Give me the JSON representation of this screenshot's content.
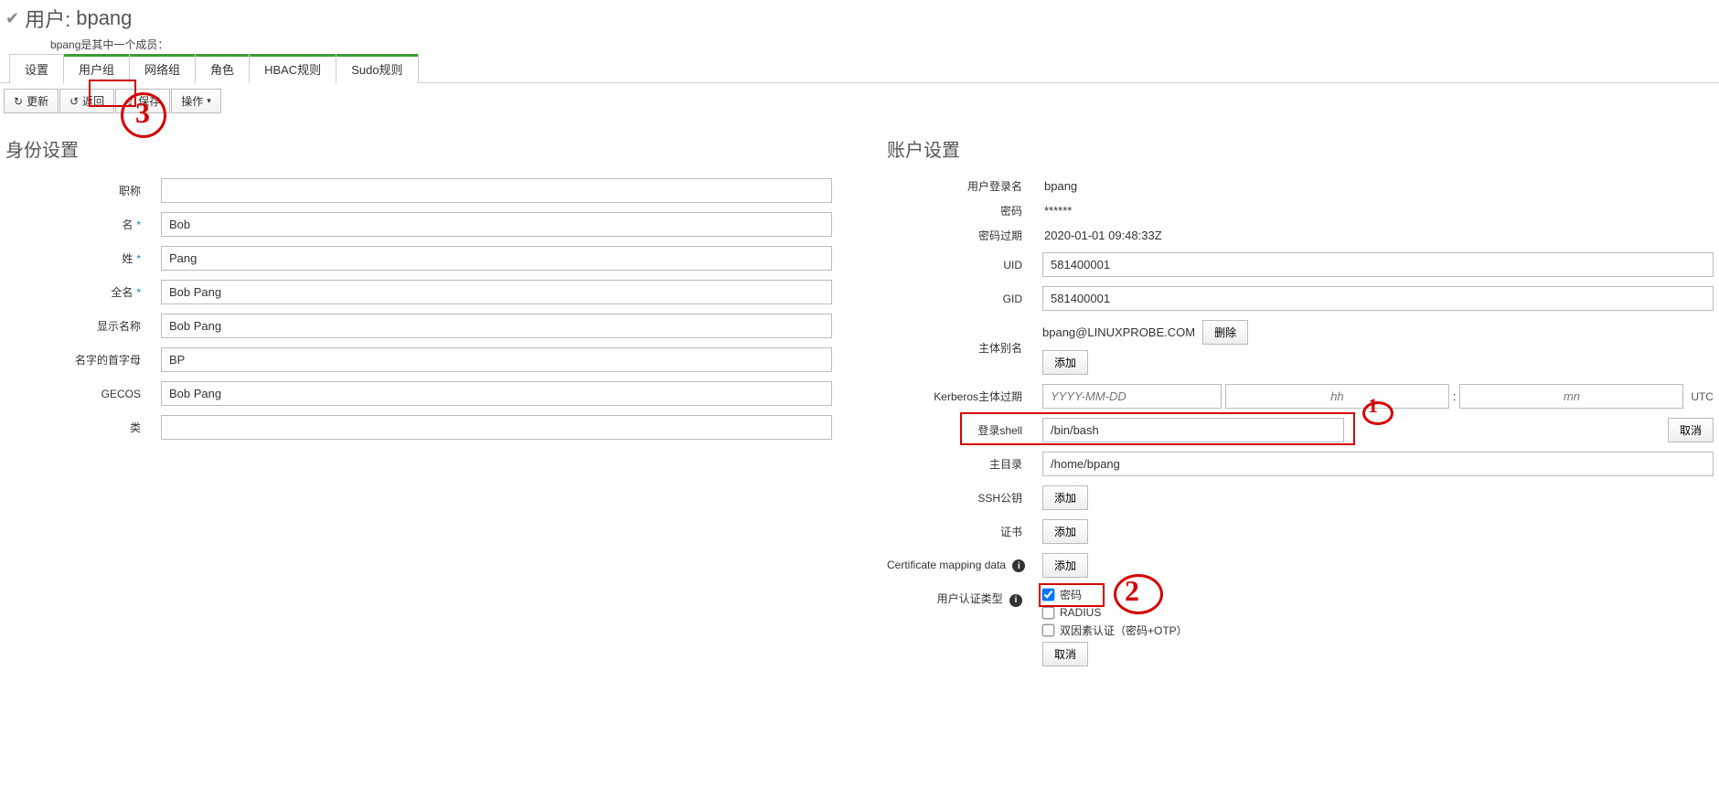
{
  "header": {
    "title_prefix": "用户:",
    "username": "bpang",
    "subtitle": "bpang是其中一个成员："
  },
  "tabs": [
    {
      "label": "设置",
      "active": true
    },
    {
      "label": "用户组"
    },
    {
      "label": "网络组"
    },
    {
      "label": "角色"
    },
    {
      "label": "HBAC规则"
    },
    {
      "label": "Sudo规则"
    }
  ],
  "toolbar": {
    "refresh": "更新",
    "back": "返回",
    "save": "保存",
    "actions": "操作"
  },
  "identity": {
    "section_title": "身份设置",
    "labels": {
      "title": "职称",
      "first": "名",
      "last": "姓",
      "full": "全名",
      "display": "显示名称",
      "initials": "名字的首字母",
      "gecos": "GECOS",
      "class": "类"
    },
    "values": {
      "title": "",
      "first": "Bob",
      "last": "Pang",
      "full": "Bob Pang",
      "display": "Bob Pang",
      "initials": "BP",
      "gecos": "Bob Pang",
      "class": ""
    }
  },
  "account": {
    "section_title": "账户设置",
    "labels": {
      "login": "用户登录名",
      "password": "密码",
      "pwd_expiry": "密码过期",
      "uid": "UID",
      "gid": "GID",
      "principal_alias": "主体别名",
      "kerberos_expiry": "Kerberos主体过期",
      "login_shell": "登录shell",
      "home": "主目录",
      "ssh_keys": "SSH公钥",
      "certs": "证书",
      "cert_map": "Certificate mapping data",
      "auth_types": "用户认证类型"
    },
    "values": {
      "login": "bpang",
      "password": "******",
      "pwd_expiry": "2020-01-01 09:48:33Z",
      "uid": "581400001",
      "gid": "581400001",
      "principal_alias": "bpang@LINUXPROBE.COM",
      "login_shell": "/bin/bash",
      "home": "/home/bpang",
      "kerberos_date_ph": "YYYY-MM-DD",
      "hh_ph": "hh",
      "mn_ph": "mn",
      "utc": "UTC"
    },
    "buttons": {
      "delete": "删除",
      "add": "添加",
      "cancel": "取消"
    },
    "auth_options": {
      "password": "密码",
      "radius": "RADIUS",
      "two_factor": "双因素认证（密码+OTP）"
    }
  },
  "annotations": {
    "one": "1",
    "two": "2",
    "three": "3"
  }
}
